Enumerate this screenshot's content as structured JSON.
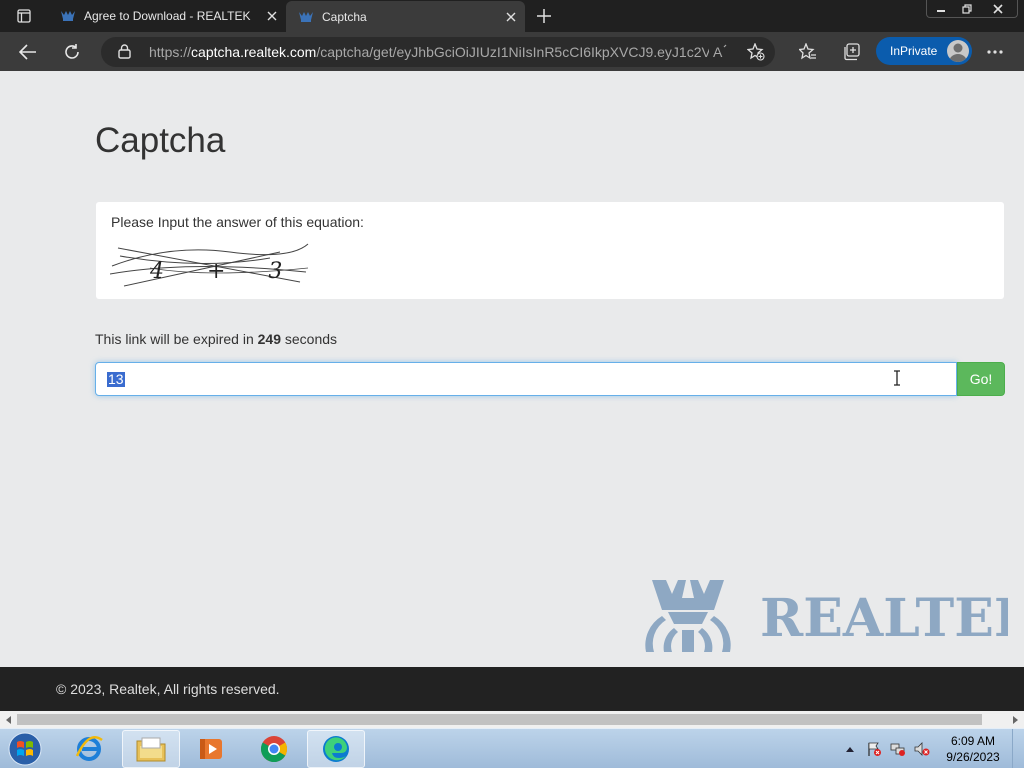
{
  "browser": {
    "tabs": [
      {
        "title": "Agree to Download - REALTEK",
        "active": false
      },
      {
        "title": "Captcha",
        "active": true
      }
    ],
    "url_prefix": "https://",
    "url_host": "captcha.realtek.com",
    "url_path": "/captcha/get/eyJhbGciOiJIUzI1NiIsInR5cCI6IkpXVCJ9.eyJ1c2V...",
    "inprivate_label": "InPrivate",
    "accent": "#0b5cad"
  },
  "page": {
    "heading": "Captcha",
    "prompt": "Please Input the answer of this equation:",
    "captcha_text": "4 + 3",
    "expire_prefix": "This link will be expired in",
    "expire_seconds": "249",
    "expire_suffix": "seconds",
    "answer_value": "13",
    "go_label": "Go!",
    "go_color": "#5cb85c",
    "logo_text": "REALTEK"
  },
  "footer": {
    "copyright": "© 2023, Realtek, All rights reserved."
  },
  "taskbar": {
    "apps": [
      "internet-explorer",
      "file-explorer",
      "media-player",
      "chrome",
      "edge"
    ],
    "time": "6:09 AM",
    "date": "9/26/2023"
  }
}
